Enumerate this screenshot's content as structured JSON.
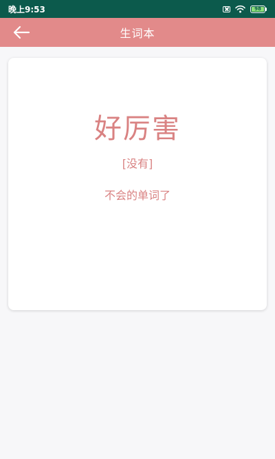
{
  "status_bar": {
    "time": "晚上9:53",
    "battery_level": "98",
    "icons": [
      "sim-off-icon",
      "wifi-icon",
      "battery-icon"
    ]
  },
  "app_bar": {
    "title": "生词本",
    "back_icon": "arrow-left-icon",
    "background_color": "#e28a8a"
  },
  "card": {
    "word": "好厉害",
    "phonetic": "[没有]",
    "meaning": "不会的单词了",
    "text_color": "#d98282"
  }
}
